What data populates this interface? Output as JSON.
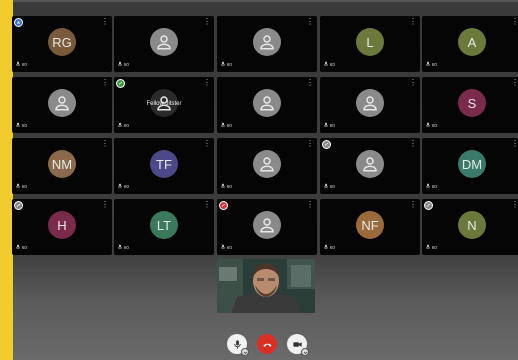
{
  "tiles": [
    {
      "initials": "RG",
      "color": "#7a5a3a",
      "badge": "blue"
    },
    {
      "initials": "",
      "color": ""
    },
    {
      "initials": "",
      "color": ""
    },
    {
      "initials": "L",
      "color": "#6b7a3a"
    },
    {
      "initials": "A",
      "color": "#6b7a3a"
    },
    {
      "initials": "",
      "color": ""
    },
    {
      "initials": "",
      "color": "",
      "label": "Fellow Jitster",
      "badge": "green"
    },
    {
      "initials": "",
      "color": ""
    },
    {
      "initials": "",
      "color": ""
    },
    {
      "initials": "S",
      "color": "#7a2a4a"
    },
    {
      "initials": "NM",
      "color": "#8a6a4a"
    },
    {
      "initials": "TF",
      "color": "#4a4a8a"
    },
    {
      "initials": "",
      "color": ""
    },
    {
      "initials": "",
      "color": "",
      "badge": "gray"
    },
    {
      "initials": "DM",
      "color": "#3a7a6a"
    },
    {
      "initials": "H",
      "color": "#7a2a4a",
      "badge": "gray"
    },
    {
      "initials": "LT",
      "color": "#3a7a5a"
    },
    {
      "initials": "",
      "color": "",
      "badge": "red"
    },
    {
      "initials": "NF",
      "color": "#9a6a3a"
    },
    {
      "initials": "N",
      "color": "#6b7a3a",
      "badge": "gray"
    }
  ],
  "mic_label": "ко",
  "colors": {
    "sidebar": "#f2cb2d",
    "hangup": "#d93025",
    "badge_blue": "#3a6fd8",
    "badge_green": "#3a9a3a",
    "badge_red": "#d03a3a",
    "badge_gray": "#888888"
  },
  "controls": {
    "mic": "microphone-icon",
    "hangup": "phone-hangup-icon",
    "camera": "camera-icon"
  }
}
